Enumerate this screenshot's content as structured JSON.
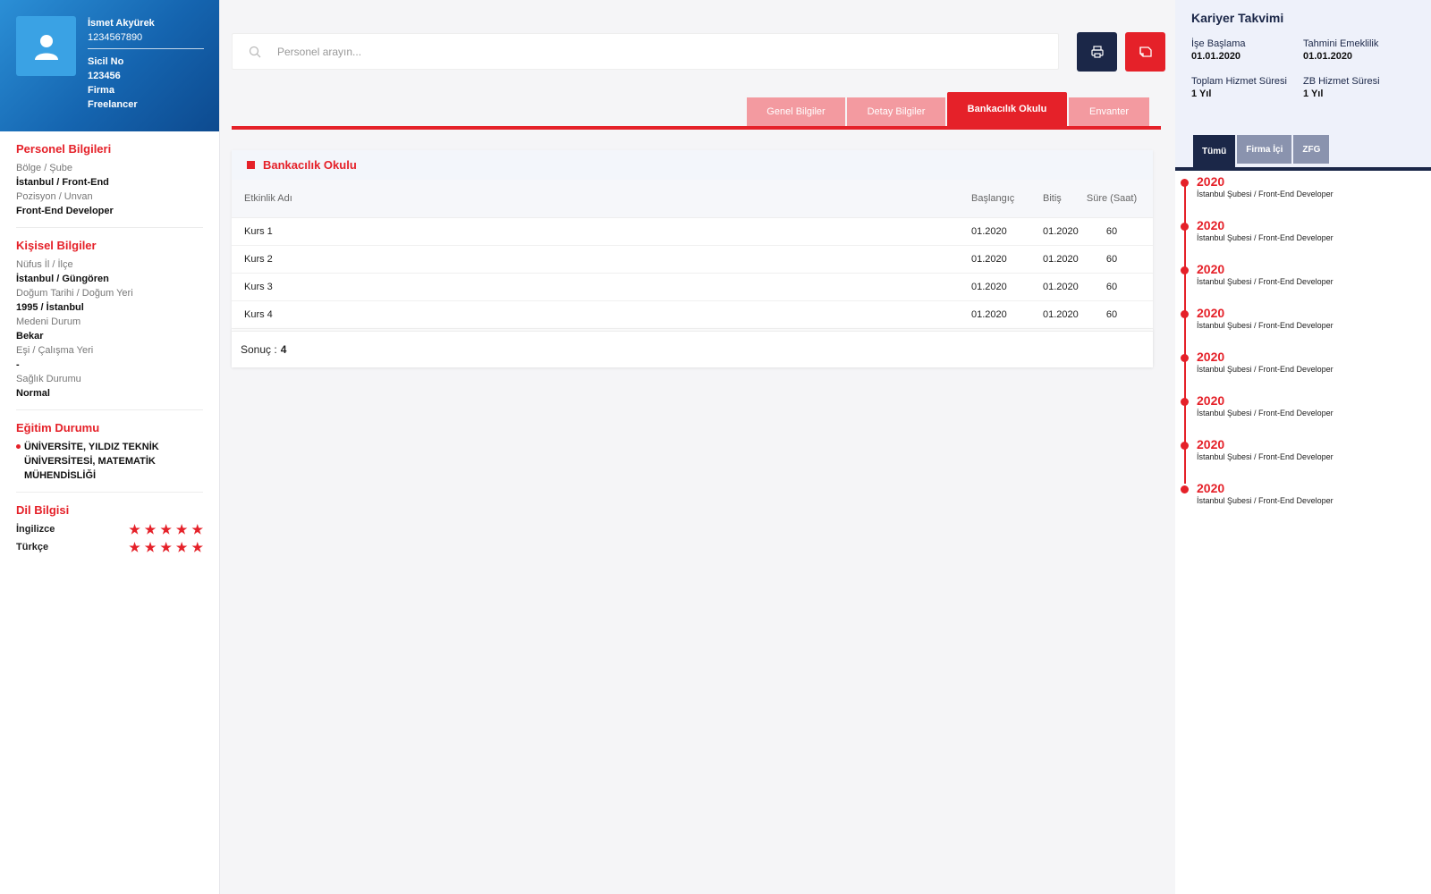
{
  "profile": {
    "name": "İsmet Akyürek",
    "phone": "1234567890",
    "sicil_label": "Sicil No",
    "sicil_value": "123456",
    "firma_label": "Firma",
    "firma_value": "Freelancer"
  },
  "personel": {
    "title": "Personel Bilgileri",
    "fields": [
      {
        "label": "Bölge / Şube",
        "value": "İstanbul / Front-End"
      },
      {
        "label": "Pozisyon / Unvan",
        "value": "Front-End Developer"
      }
    ]
  },
  "kisisel": {
    "title": "Kişisel Bilgiler",
    "fields": [
      {
        "label": "Nüfus İl / İlçe",
        "value": "İstanbul / Güngören"
      },
      {
        "label": "Doğum Tarihi / Doğum Yeri",
        "value": "1995 / İstanbul"
      },
      {
        "label": "Medeni Durum",
        "value": "Bekar"
      },
      {
        "label": "Eşi / Çalışma Yeri",
        "value": "-"
      },
      {
        "label": "Sağlık Durumu",
        "value": "Normal"
      }
    ]
  },
  "egitim": {
    "title": "Eğitim Durumu",
    "items": [
      "ÜNİVERSİTE, YILDIZ TEKNİK ÜNİVERSİTESİ, MATEMATİK MÜHENDİSLİĞİ"
    ]
  },
  "dil": {
    "title": "Dil Bilgisi",
    "items": [
      {
        "name": "İngilizce",
        "rating": 5,
        "max": 5
      },
      {
        "name": "Türkçe",
        "rating": 5,
        "max": 5
      }
    ]
  },
  "search": {
    "placeholder": "Personel arayın..."
  },
  "tabs": [
    {
      "label": "Genel Bilgiler",
      "active": false
    },
    {
      "label": "Detay Bilgiler",
      "active": false
    },
    {
      "label": "Bankacılık Okulu",
      "active": true
    },
    {
      "label": "Envanter",
      "active": false
    }
  ],
  "table": {
    "title": "Bankacılık Okulu",
    "headers": {
      "name": "Etkinlik Adı",
      "start": "Başlangıç",
      "end": "Bitiş",
      "duration": "Süre (Saat)"
    },
    "rows": [
      {
        "name": "Kurs 1",
        "start": "01.2020",
        "end": "01.2020",
        "duration": "60"
      },
      {
        "name": "Kurs 2",
        "start": "01.2020",
        "end": "01.2020",
        "duration": "60"
      },
      {
        "name": "Kurs 3",
        "start": "01.2020",
        "end": "01.2020",
        "duration": "60"
      },
      {
        "name": "Kurs 4",
        "start": "01.2020",
        "end": "01.2020",
        "duration": "60"
      }
    ],
    "result_label": "Sonuç :",
    "result_count": "4"
  },
  "career": {
    "title": "Kariyer Takvimi",
    "fields": [
      {
        "label": "İşe Başlama",
        "value": "01.01.2020"
      },
      {
        "label": "Tahmini Emeklilik",
        "value": "01.01.2020"
      },
      {
        "label": "Toplam Hizmet Süresi",
        "value": "1 Yıl"
      },
      {
        "label": "ZB Hizmet Süresi",
        "value": "1 Yıl"
      }
    ],
    "tabs": [
      {
        "label": "Tümü",
        "active": true
      },
      {
        "label": "Firma İçi",
        "active": false
      },
      {
        "label": "ZFG",
        "active": false
      }
    ],
    "timeline": [
      {
        "year": "2020",
        "desc": "İstanbul Şubesi / Front-End Developer"
      },
      {
        "year": "2020",
        "desc": "İstanbul Şubesi / Front-End Developer"
      },
      {
        "year": "2020",
        "desc": "İstanbul Şubesi / Front-End Developer"
      },
      {
        "year": "2020",
        "desc": "İstanbul Şubesi / Front-End Developer"
      },
      {
        "year": "2020",
        "desc": "İstanbul Şubesi / Front-End Developer"
      },
      {
        "year": "2020",
        "desc": "İstanbul Şubesi / Front-End Developer"
      },
      {
        "year": "2020",
        "desc": "İstanbul Şubesi / Front-End Developer"
      },
      {
        "year": "2020",
        "desc": "İstanbul Şubesi / Front-End Developer"
      }
    ]
  },
  "icons": {
    "avatar": "user-icon",
    "search": "search-icon",
    "print": "print-icon",
    "export": "export-icon",
    "star": "star-icon"
  },
  "colors": {
    "accent": "#e52129",
    "navy": "#1b2748",
    "tab_inactive": "#f39aa0",
    "profile_blue": "#1565b0"
  }
}
